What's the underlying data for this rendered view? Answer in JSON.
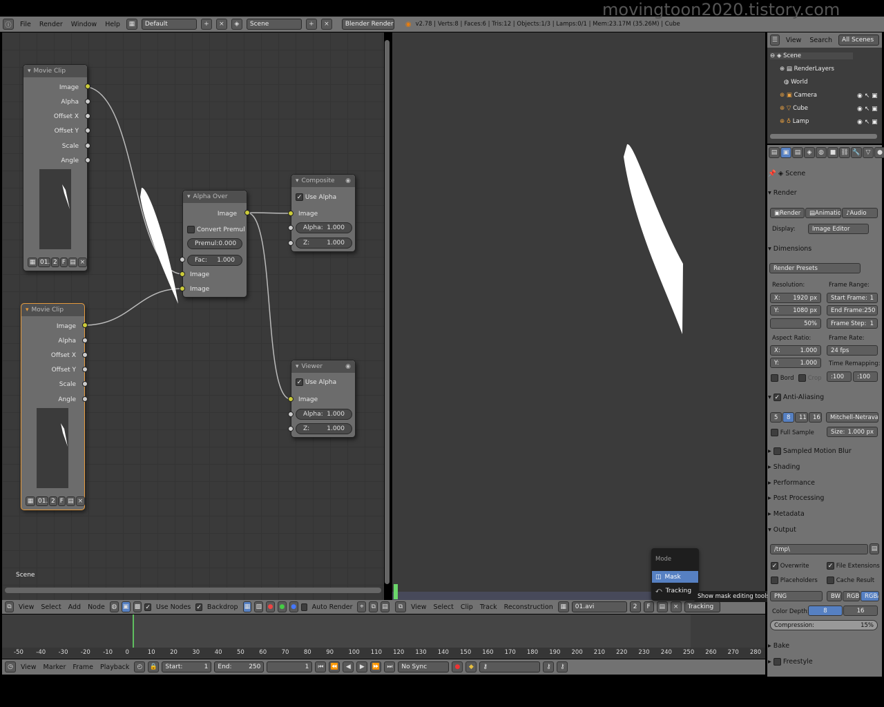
{
  "watermark": "movingtoon2020.tistory.com",
  "topbar": {
    "menus": [
      "File",
      "Render",
      "Window",
      "Help"
    ],
    "layout": "Default",
    "scene": "Scene",
    "engine": "Blender Render",
    "stats": "v2.78 | Verts:8 | Faces:6 | Tris:12 | Objects:1/3 | Lamps:0/1 | Mem:23.17M (35.26M) | Cube"
  },
  "node_editor": {
    "corner_label": "Scene",
    "movie_clip1": {
      "title": "Movie Clip",
      "outputs": [
        "Image",
        "Alpha",
        "Offset X",
        "Offset Y",
        "Scale",
        "Angle"
      ],
      "frame": "01.",
      "users": "2",
      "fake": "F"
    },
    "movie_clip2": {
      "title": "Movie Clip",
      "outputs": [
        "Image",
        "Alpha",
        "Offset X",
        "Offset Y",
        "Scale",
        "Angle"
      ],
      "frame": "01.",
      "users": "2",
      "fake": "F"
    },
    "alpha_over": {
      "title": "Alpha Over",
      "output": "Image",
      "convert_label": "Convert Premul",
      "premul_label": "Premul:",
      "premul_value": "0.000",
      "fac_label": "Fac:",
      "fac_value": "1.000",
      "in1": "Image",
      "in2": "Image"
    },
    "composite": {
      "title": "Composite",
      "use_alpha": "Use Alpha",
      "image": "Image",
      "alpha_label": "Alpha:",
      "alpha_value": "1.000",
      "z_label": "Z:",
      "z_value": "1.000"
    },
    "viewer": {
      "title": "Viewer",
      "use_alpha": "Use Alpha",
      "image": "Image",
      "alpha_label": "Alpha:",
      "alpha_value": "1.000",
      "z_label": "Z:",
      "z_value": "1.000"
    },
    "header": {
      "menus": [
        "View",
        "Select",
        "Add",
        "Node"
      ],
      "use_nodes": "Use Nodes",
      "backdrop": "Backdrop",
      "auto_render": "Auto Render"
    }
  },
  "clip_editor": {
    "header": {
      "menus": [
        "View",
        "Select",
        "Clip",
        "Track",
        "Reconstruction"
      ],
      "clip": "01.avi",
      "users": "2",
      "fake": "F",
      "mode": "Tracking"
    },
    "mode_popup": {
      "title": "Mode",
      "items": [
        "Mask",
        "Tracking"
      ],
      "selected": "Mask"
    },
    "tooltip": "Show mask editing tools"
  },
  "outliner": {
    "menus": [
      "View",
      "Search"
    ],
    "filter": "All Scenes",
    "items": [
      "Scene",
      "RenderLayers",
      "World",
      "Camera",
      "Cube",
      "Lamp"
    ]
  },
  "properties": {
    "context": "Scene",
    "render": {
      "title": "Render",
      "buttons": [
        "Render",
        "Animation",
        "Audio"
      ],
      "display_label": "Display:",
      "display_value": "Image Editor"
    },
    "dimensions": {
      "title": "Dimensions",
      "presets": "Render Presets",
      "resolution_label": "Resolution:",
      "res_x": "1920 px",
      "res_y": "1080 px",
      "res_pct": "50%",
      "frame_range_label": "Frame Range:",
      "start": "Start Frame:",
      "start_v": "1",
      "end": "End Frame:",
      "end_v": "250",
      "step": "Frame Step:",
      "step_v": "1",
      "aspect_label": "Aspect Ratio:",
      "asp_x": "1.000",
      "asp_y": "1.000",
      "frame_rate_label": "Frame Rate:",
      "fps": "24 fps",
      "remap_label": "Time Remapping:",
      "remap_old": ":100",
      "remap_new": ":100",
      "bord": "Bord",
      "crop": "Crop",
      "x": "X:",
      "y": "Y:"
    },
    "aa": {
      "title": "Anti-Aliasing",
      "samples": [
        "5",
        "8",
        "11",
        "16"
      ],
      "filter": "Mitchell-Netravali",
      "full_sample": "Full Sample",
      "size_label": "Size:",
      "size": "1.000 px"
    },
    "collapsed": [
      "Sampled Motion Blur",
      "Shading",
      "Performance",
      "Post Processing",
      "Metadata"
    ],
    "output": {
      "title": "Output",
      "path": "/tmp\\",
      "overwrite": "Overwrite",
      "file_ext": "File Extensions",
      "placeholders": "Placeholders",
      "cache": "Cache Result",
      "format": "PNG",
      "bw": "BW",
      "rgb": "RGB",
      "rgba": "RGBA",
      "depth_label": "Color Depth:",
      "d8": "8",
      "d16": "16",
      "compression": "Compression:",
      "comp_v": "15%"
    },
    "bottom": [
      "Bake",
      "Freestyle"
    ]
  },
  "timeline": {
    "ticks": [
      "-50",
      "-40",
      "-30",
      "-20",
      "-10",
      "0",
      "10",
      "20",
      "30",
      "40",
      "50",
      "60",
      "70",
      "80",
      "90",
      "100",
      "110",
      "120",
      "130",
      "140",
      "150",
      "160",
      "170",
      "180",
      "190",
      "200",
      "210",
      "220",
      "230",
      "240",
      "250",
      "260",
      "270",
      "280"
    ],
    "menus": [
      "View",
      "Marker",
      "Frame",
      "Playback"
    ],
    "start_label": "Start:",
    "start": "1",
    "end_label": "End:",
    "end": "250",
    "current": "1",
    "sync": "No Sync"
  }
}
